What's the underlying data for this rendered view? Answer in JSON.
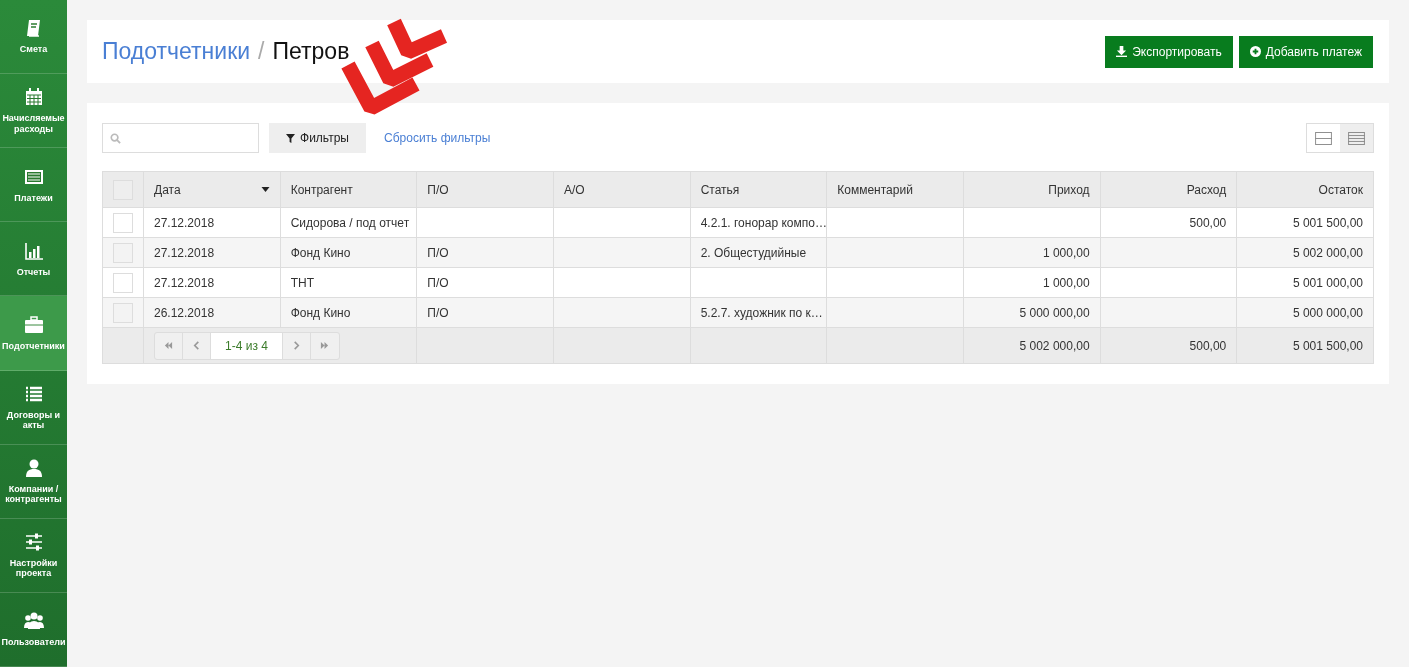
{
  "sidebar": {
    "items": [
      {
        "label": "Смета",
        "selected": false
      },
      {
        "label": "Начисляемые расходы",
        "selected": false
      },
      {
        "label": "Платежи",
        "selected": false
      },
      {
        "label": "Отчеты",
        "selected": false
      },
      {
        "label": "Подотчетники",
        "selected": true
      },
      {
        "label": "Договоры и акты",
        "selected": false
      },
      {
        "label": "Компании / контрагенты",
        "selected": false
      },
      {
        "label": "Настройки проекта",
        "selected": false
      },
      {
        "label": "Пользователи",
        "selected": false
      }
    ]
  },
  "header": {
    "breadcrumb_link": "Подотчетники",
    "separator": "/",
    "title": "Петров",
    "buttons": [
      {
        "label": "Экспортировать",
        "kind": "download"
      },
      {
        "label": "Добавить платеж",
        "kind": "add"
      }
    ]
  },
  "toolbar": {
    "filters_button": "Фильтры",
    "reset_link": "Сбросить фильтры",
    "view_toggle": [
      {
        "kind": "split",
        "selected": false
      },
      {
        "kind": "rows",
        "selected": true
      }
    ]
  },
  "table": {
    "header_checkbox": {
      "checked": false
    },
    "columns": [
      {
        "label": "Дата",
        "kind": "text",
        "sorted": true
      },
      {
        "label": "Контрагент",
        "kind": "text",
        "sorted": false
      },
      {
        "label": "П/О",
        "kind": "text",
        "sorted": false
      },
      {
        "label": "А/О",
        "kind": "text",
        "sorted": false
      },
      {
        "label": "Статья",
        "kind": "text",
        "sorted": false
      },
      {
        "label": "Комментарий",
        "kind": "text",
        "sorted": false
      },
      {
        "label": "Приход",
        "kind": "amount",
        "sorted": false
      },
      {
        "label": "Расход",
        "kind": "amount",
        "sorted": false
      },
      {
        "label": "Остаток",
        "kind": "amount",
        "sorted": false
      }
    ],
    "rows": [
      {
        "checked": false,
        "cells": [
          "27.12.2018",
          "Сидорова / под отчет",
          "",
          "",
          "4.2.1. гонорар компо…",
          "",
          "",
          "500,00",
          "5 001 500,00"
        ]
      },
      {
        "checked": false,
        "cells": [
          "27.12.2018",
          "Фонд Кино",
          "П/О",
          "",
          "2. Общестудийные",
          "",
          "1 000,00",
          "",
          "5 002 000,00"
        ]
      },
      {
        "checked": false,
        "cells": [
          "27.12.2018",
          "ТНТ",
          "П/О",
          "",
          "",
          "",
          "1 000,00",
          "",
          "5 001 000,00"
        ]
      },
      {
        "checked": false,
        "cells": [
          "26.12.2018",
          "Фонд Кино",
          "П/О",
          "",
          "5.2.7. художник по к…",
          "",
          "5 000 000,00",
          "",
          "5 000 000,00"
        ]
      }
    ],
    "footer": {
      "pager": "1-4 из 4",
      "totals": [
        "5 002 000,00",
        "500,00",
        "5 001 500,00"
      ]
    }
  }
}
